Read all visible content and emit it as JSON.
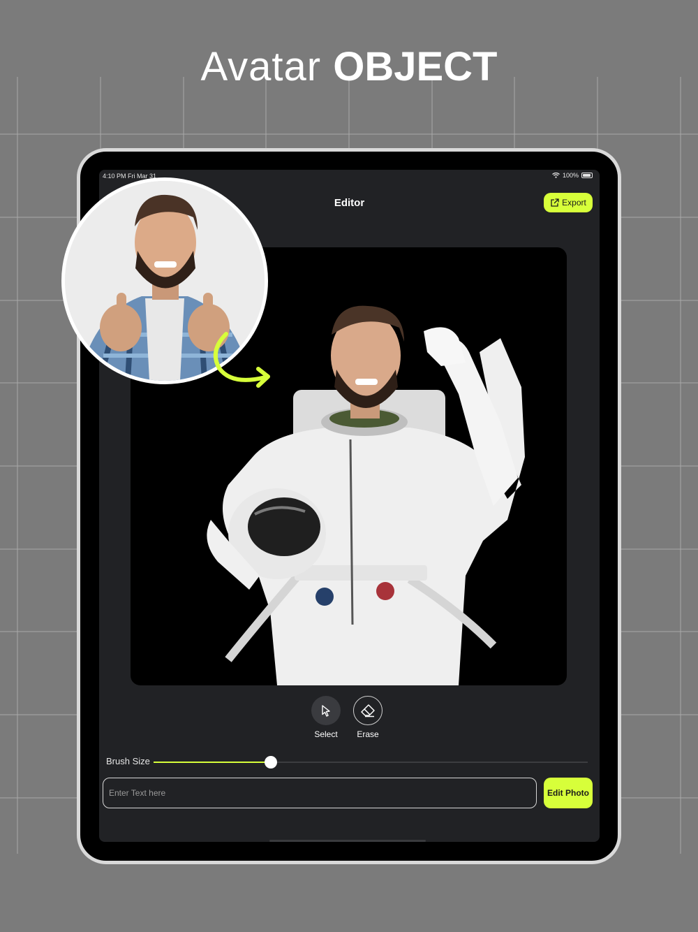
{
  "headline": {
    "light": "Avatar",
    "bold": "OBJECT"
  },
  "status_bar": {
    "time": "4:10 PM  Fri Mar 31",
    "battery": "100%"
  },
  "header": {
    "title": "Editor",
    "export_label": "Export"
  },
  "tools": [
    {
      "label": "Select",
      "icon": "cursor-arrow-icon"
    },
    {
      "label": "Erase",
      "icon": "eraser-icon"
    }
  ],
  "brush": {
    "label": "Brush Size",
    "value": 0.27
  },
  "prompt": {
    "placeholder": "Enter Text here",
    "value": ""
  },
  "actions": {
    "edit_label": "Edit Photo"
  },
  "colors": {
    "accent": "#d7ff3a",
    "panel": "#212225",
    "canvas": "#000000",
    "background": "#7b7b7b"
  }
}
